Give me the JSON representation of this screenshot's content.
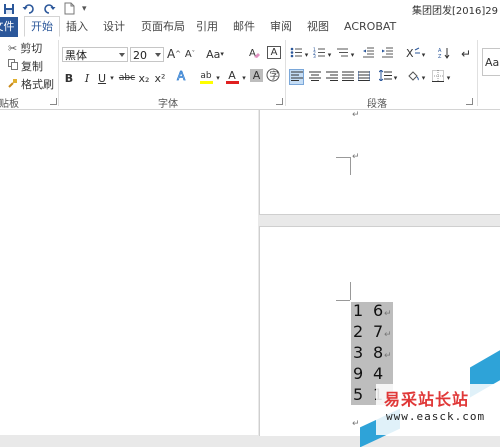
{
  "window": {
    "title": "集团团发[2016]29"
  },
  "quick_access": {
    "icons": [
      "save-icon",
      "undo-icon",
      "redo-icon",
      "new-doc-icon"
    ],
    "more": "▾"
  },
  "tabs": {
    "file": "文件",
    "items": [
      "开始",
      "插入",
      "设计",
      "页面布局",
      "引用",
      "邮件",
      "审阅",
      "视图",
      "ACROBAT"
    ]
  },
  "clipboard": {
    "cut": "剪切",
    "copy": "复制",
    "format_painter": "格式刷",
    "group_label": "剪贴板"
  },
  "font": {
    "family": "黑体",
    "size": "20",
    "group_label": "字体",
    "grow": "A",
    "shrink": "A",
    "case": "Aa",
    "clear": "A",
    "bold": "B",
    "italic": "I",
    "underline": "U",
    "strike": "abc",
    "subscript": "x₂",
    "superscript": "x²",
    "effects": "A",
    "highlight": "ab",
    "color": "A",
    "shading": "A",
    "border": "A",
    "colors": {
      "highlight": "#ffff00",
      "font_color": "#e02020"
    }
  },
  "paragraph": {
    "group_label": "段落"
  },
  "styles": {
    "preview": "AaB"
  },
  "document": {
    "table_cells": [
      {
        "left": "1",
        "right": "6"
      },
      {
        "left": "2",
        "right": "7"
      },
      {
        "left": "3",
        "right": "8"
      },
      {
        "left": "9",
        "right": "4"
      },
      {
        "left": "5",
        "right": "1"
      }
    ],
    "para_mark": "↵"
  },
  "watermark": {
    "text": "易采站长站",
    "url": "www.easck.com",
    "colors": {
      "stripe": "#2ea3d8",
      "text": "#e03838"
    }
  }
}
